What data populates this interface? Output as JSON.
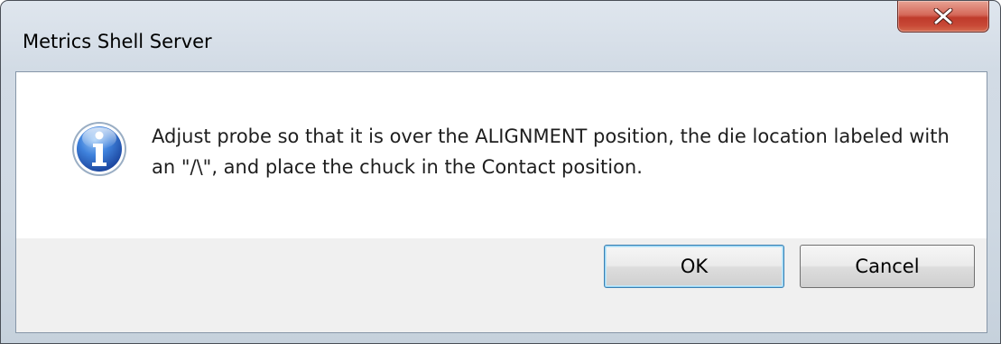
{
  "window": {
    "title": "Metrics Shell Server",
    "close_icon": "close-icon"
  },
  "message": {
    "icon": "information-icon",
    "text": "Adjust probe so that it is over the ALIGNMENT position, the die location labeled with an \"/\\\", and place the chuck in the Contact position."
  },
  "buttons": {
    "ok_label": "OK",
    "cancel_label": "Cancel"
  },
  "colors": {
    "close_button": "#c84836",
    "info_icon": "#2f6fd0",
    "button_area": "#f0f0f0"
  }
}
